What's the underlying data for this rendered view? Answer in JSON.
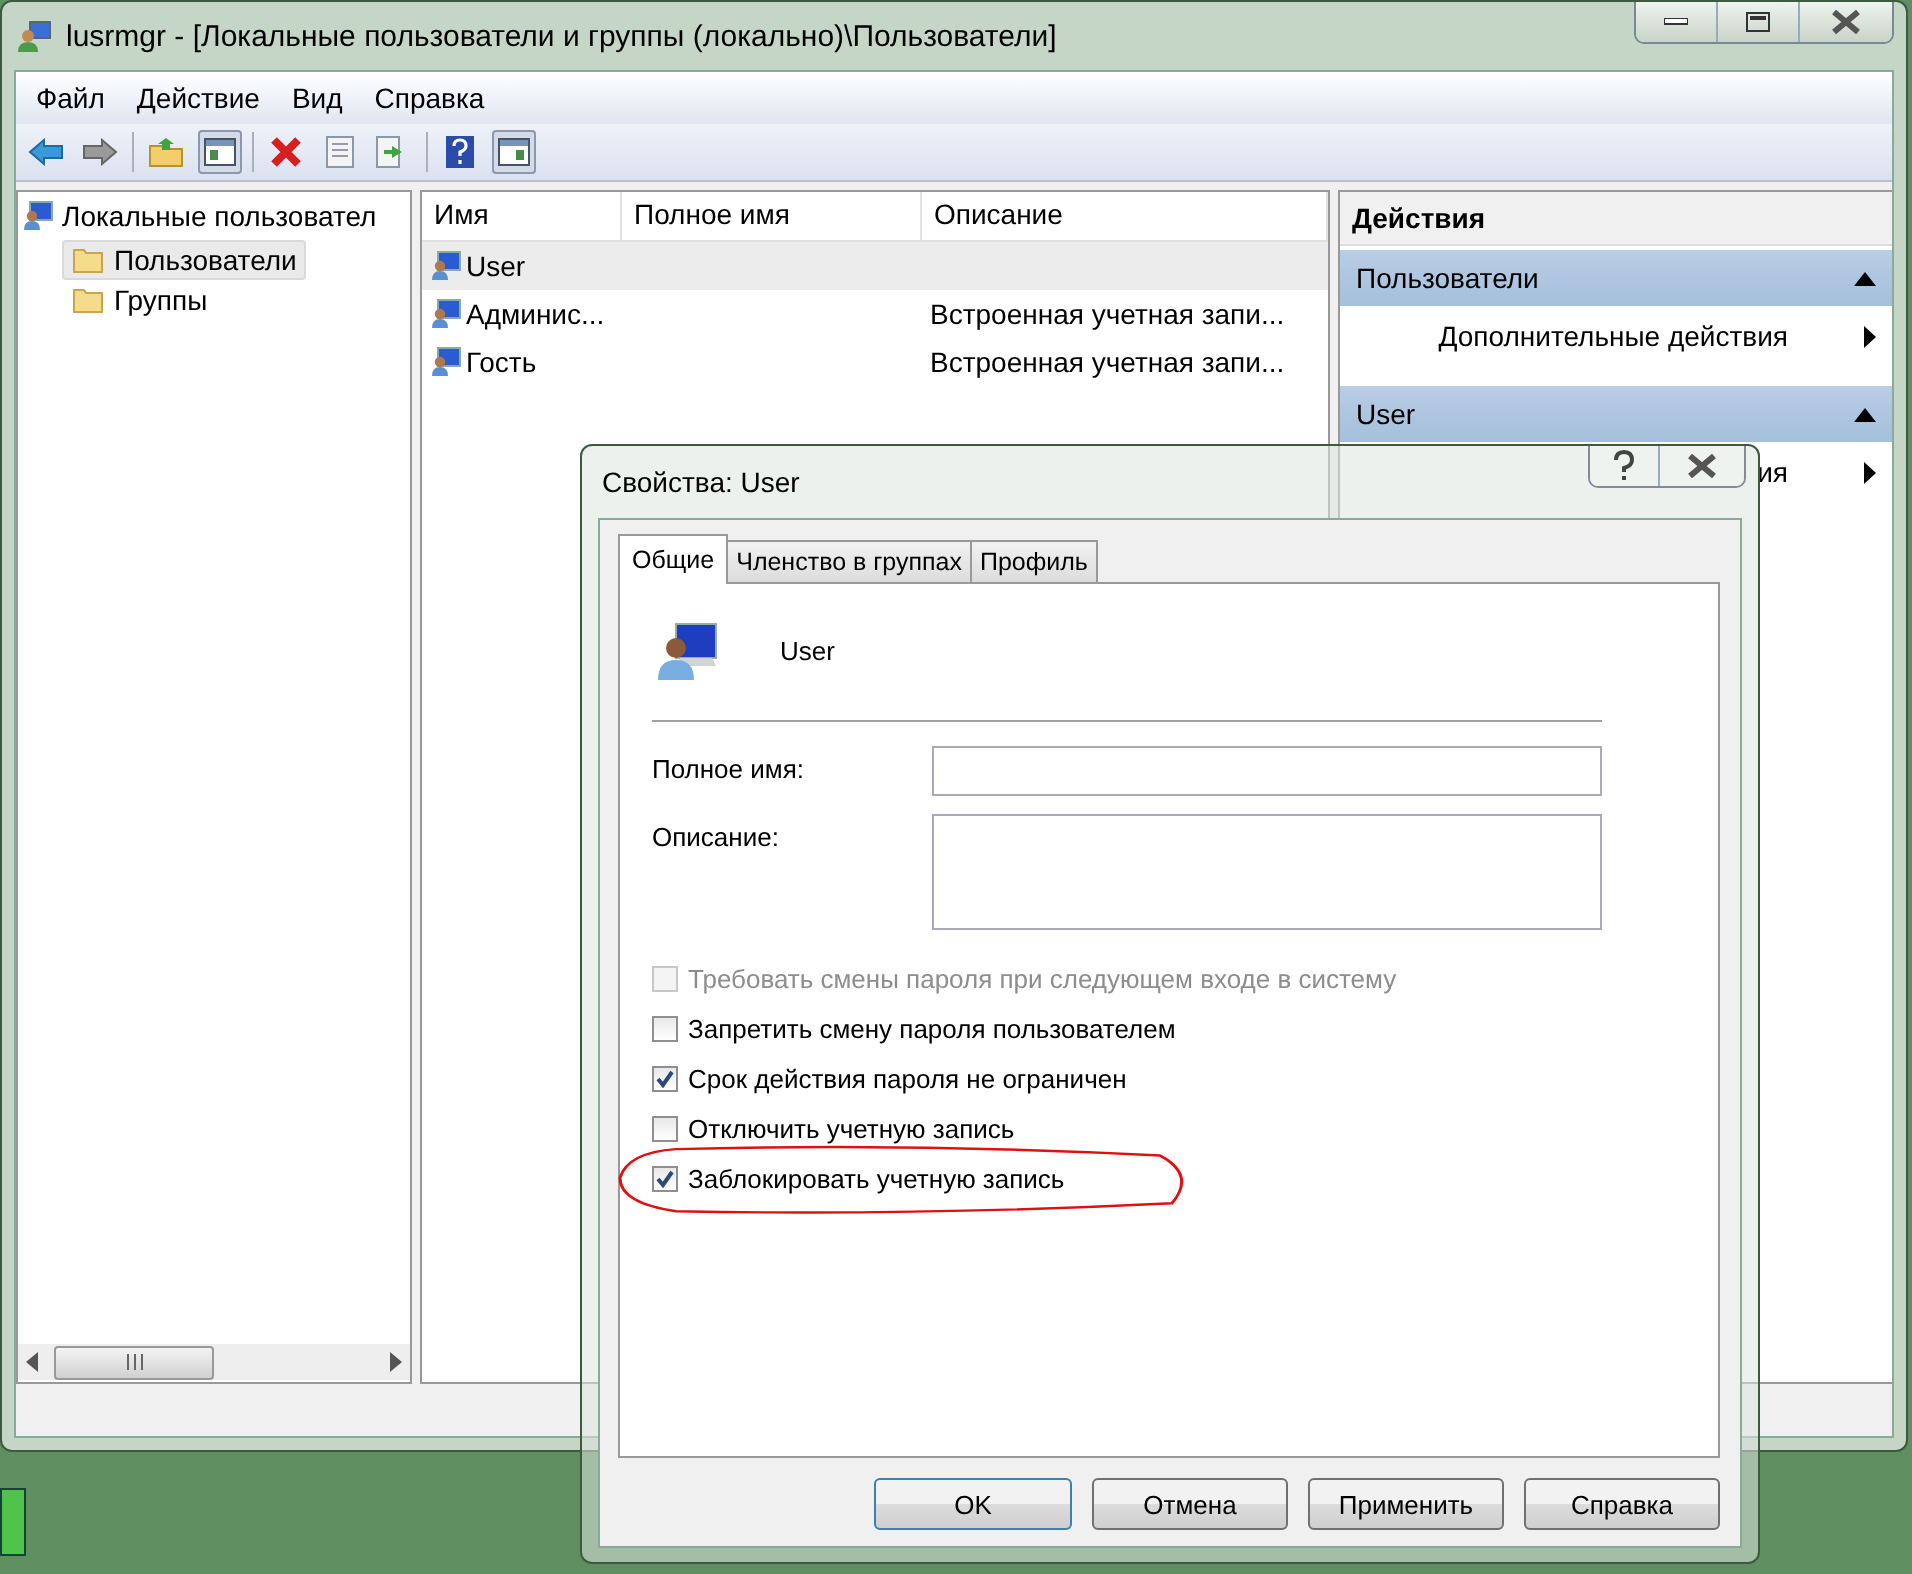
{
  "window": {
    "title": "lusrmgr - [Локальные пользователи и группы (локально)\\Пользователи]"
  },
  "menu": [
    "Файл",
    "Действие",
    "Вид",
    "Справка"
  ],
  "tree": {
    "label": "Локальные пользовател",
    "children": [
      {
        "label": "Пользователи",
        "selected": true
      },
      {
        "label": "Группы",
        "selected": false
      }
    ]
  },
  "list": {
    "columns": [
      "Имя",
      "Полное имя",
      "Описание"
    ],
    "rows": [
      {
        "name": "User",
        "selected": true
      },
      {
        "name": "Админис...",
        "description": "Встроенная учетная запи...",
        "selected": false
      },
      {
        "name": "Гость",
        "description": "Встроенная учетная запи...",
        "selected": false
      }
    ]
  },
  "actions": {
    "title": "Действия",
    "sections": [
      {
        "header": "Пользователи",
        "expanded": true,
        "items": [
          "Дополнительные действия"
        ]
      },
      {
        "header": "User",
        "expanded": true,
        "items": [
          "ия"
        ]
      }
    ]
  },
  "dialog": {
    "title": "Свойства: User",
    "tabs": [
      {
        "label": "Общие",
        "selected": true
      },
      {
        "label": "Членство в группах",
        "selected": false
      },
      {
        "label": "Профиль",
        "selected": false
      }
    ],
    "user_name": "User",
    "fields": [
      {
        "label": "Полное имя:",
        "kind": "input"
      },
      {
        "label": "Описание:",
        "kind": "textarea"
      }
    ],
    "checkboxes": [
      {
        "label": "Требовать смены пароля при следующем входе в систему",
        "checked": false,
        "disabled": true
      },
      {
        "label": "Запретить смену пароля пользователем",
        "checked": false,
        "disabled": false
      },
      {
        "label": "Срок действия пароля не ограничен",
        "checked": true,
        "disabled": false
      },
      {
        "label": "Отключить учетную запись",
        "checked": false,
        "disabled": false
      },
      {
        "label": "Заблокировать учетную запись",
        "checked": true,
        "disabled": false
      }
    ],
    "buttons": [
      "OK",
      "Отмена",
      "Применить",
      "Справка"
    ]
  }
}
